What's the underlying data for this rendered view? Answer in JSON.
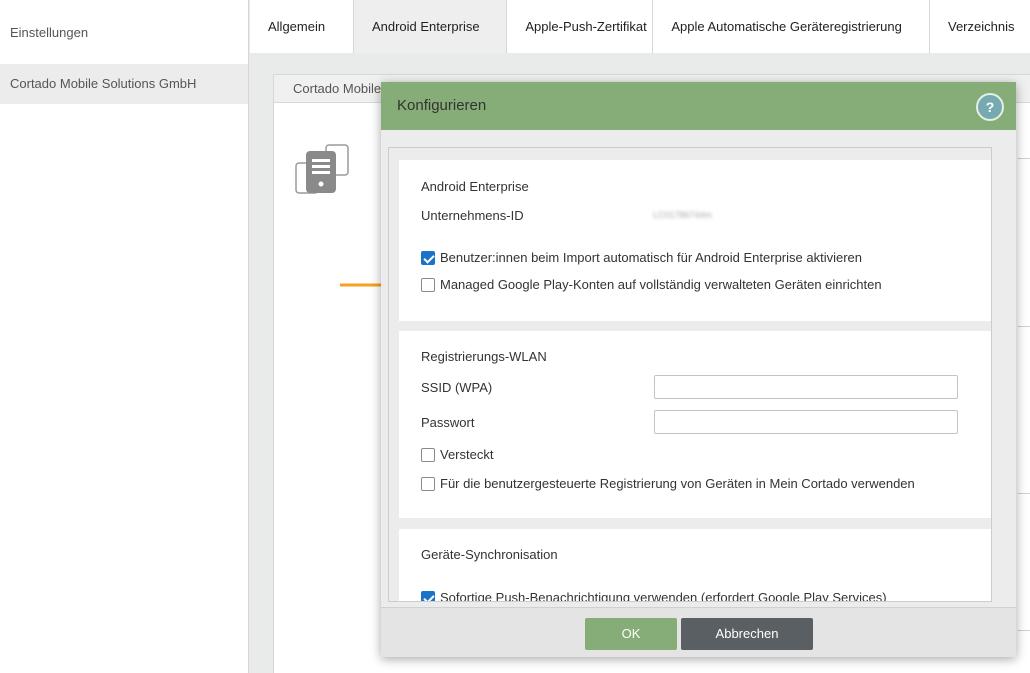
{
  "sidebar": {
    "items": [
      {
        "label": "Einstellungen"
      },
      {
        "label": "Cortado Mobile Solutions GmbH"
      }
    ]
  },
  "tabs": [
    {
      "label": "Allgemein"
    },
    {
      "label": "Android Enterprise"
    },
    {
      "label": "Apple-Push-Zertifikat"
    },
    {
      "label": "Apple Automatische Geräteregistrierung"
    },
    {
      "label": "Verzeichnis"
    }
  ],
  "content": {
    "header": "Cortado Mobile"
  },
  "dialog": {
    "title": "Konfigurieren",
    "help": "?",
    "android": {
      "title": "Android Enterprise",
      "company_id_label": "Unternehmens-ID",
      "company_id_value": "LC01786744m",
      "auto_activate_label": "Benutzer:innen beim Import automatisch für Android Enterprise aktivieren",
      "auto_activate_checked": true,
      "managed_play_label": "Managed Google Play-Konten auf vollständig verwalteten Geräten einrichten",
      "managed_play_checked": false
    },
    "wlan": {
      "title": "Registrierungs-WLAN",
      "ssid_label": "SSID (WPA)",
      "ssid_value": "",
      "password_label": "Passwort",
      "password_value": "",
      "hidden_label": "Versteckt",
      "hidden_checked": false,
      "user_reg_label": "Für die benutzergesteuerte Registrierung von Geräten in Mein Cortado verwenden",
      "user_reg_checked": false
    },
    "sync": {
      "title": "Geräte-Synchronisation",
      "push_label": "Sofortige Push-Benachrichtigung verwenden (erfordert Google Play Services)",
      "push_checked": true
    },
    "buttons": {
      "ok": "OK",
      "cancel": "Abbrechen"
    }
  },
  "colors": {
    "header_green": "#86ac77",
    "checkbox_blue": "#1a73c9",
    "cancel_gray": "#5a5f63",
    "arrow_orange": "#f5a020"
  }
}
